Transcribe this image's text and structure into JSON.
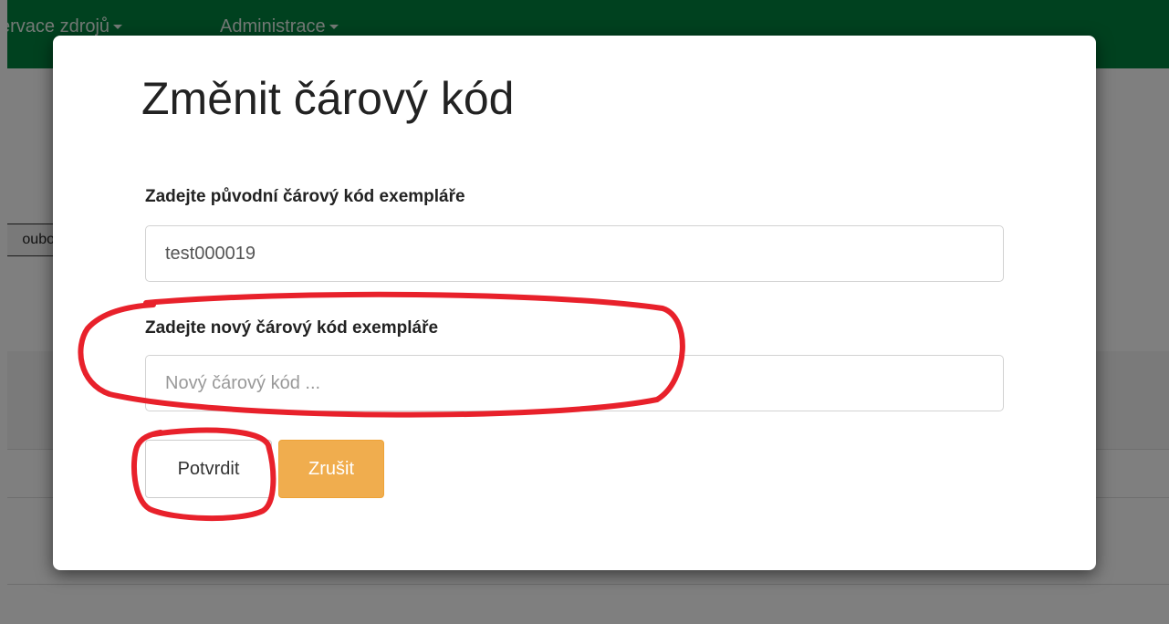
{
  "navbar": {
    "items": [
      {
        "label": "ervace zdrojů"
      },
      {
        "label": "Administrace"
      }
    ]
  },
  "background": {
    "button_label": "oubo"
  },
  "modal": {
    "title": "Změnit čárový kód",
    "original_barcode": {
      "label": "Zadejte původní čárový kód exempláře",
      "value": "test000019"
    },
    "new_barcode": {
      "label": "Zadejte nový čárový kód exempláře",
      "placeholder": "Nový čárový kód ..."
    },
    "buttons": {
      "confirm_label": "Potvrdit",
      "cancel_label": "Zrušit"
    }
  },
  "colors": {
    "navbar": "#00833f",
    "cancel_button": "#f0ad4e",
    "annotation": "#e8212b"
  }
}
